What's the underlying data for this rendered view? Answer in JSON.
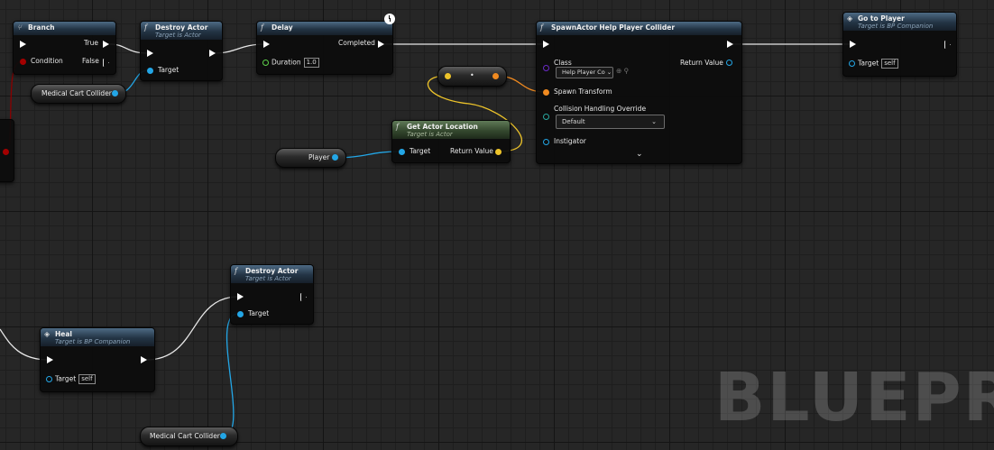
{
  "watermark": "BLUEPRIN",
  "nodes": {
    "branch": {
      "title": "Branch",
      "pin_true": "True",
      "pin_false": "False",
      "pin_condition": "Condition"
    },
    "destroy1": {
      "title": "Destroy Actor",
      "subtitle": "Target is Actor",
      "pin_target": "Target"
    },
    "delay": {
      "title": "Delay",
      "pin_completed": "Completed",
      "pin_duration": "Duration",
      "duration_value": "1.0"
    },
    "spawn": {
      "title": "SpawnActor Help Player Collider",
      "pin_class": "Class",
      "class_value": "Help Player Co",
      "pin_return": "Return Value",
      "pin_spawn_transform": "Spawn Transform",
      "pin_collision": "Collision Handling Override",
      "collision_value": "Default",
      "pin_instigator": "Instigator"
    },
    "goto": {
      "title": "Go to Player",
      "subtitle": "Target is BP Companion",
      "pin_target": "Target",
      "target_value": "self"
    },
    "get_loc": {
      "title": "Get Actor Location",
      "subtitle": "Target is Actor",
      "pin_target": "Target",
      "pin_return": "Return Value"
    },
    "destroy2": {
      "title": "Destroy Actor",
      "subtitle": "Target is Actor",
      "pin_target": "Target"
    },
    "heal": {
      "title": "Heal",
      "subtitle": "Target is BP Companion",
      "pin_target": "Target",
      "target_value": "self"
    }
  },
  "variables": {
    "medical_cart_1": "Medical Cart Collider",
    "player": "Player",
    "medical_cart_2": "Medical Cart Collider"
  },
  "icons": {
    "function": "function-icon",
    "event": "event-diamond-icon",
    "branch": "branch-icon",
    "latent": "clock-icon"
  },
  "colors": {
    "exec": "#ffffff",
    "object": "#23a6e6",
    "transform": "#f08a20",
    "vector": "#eec42a",
    "bool": "#a30000",
    "float": "#5ed24a",
    "class": "#6a2ac8"
  }
}
